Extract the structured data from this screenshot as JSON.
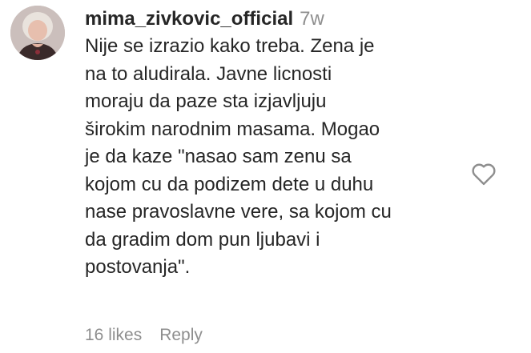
{
  "comment": {
    "username": "mima_zivkovic_official",
    "time": "7w",
    "lines": [
      "Nije se izrazio kako treba. Zena je",
      "na to aludirala. Javne licnosti",
      "moraju da paze sta izjavljuju",
      "širokim narodnim masama. Mogao",
      "je da kaze \"nasao sam zenu sa",
      "kojom cu da podizem dete u duhu",
      "nase pravoslavne vere, sa kojom cu",
      "da gradim dom pun ljubavi i",
      "postovanja\"."
    ],
    "likes": "16 likes",
    "reply": "Reply",
    "like_icon": "heart-outline-icon"
  },
  "colors": {
    "text": "#262626",
    "muted": "#8e8e8e",
    "background": "#ffffff"
  }
}
